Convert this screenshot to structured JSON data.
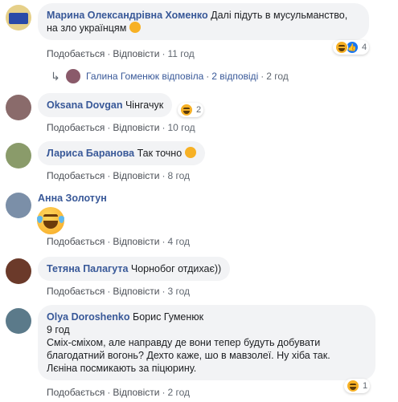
{
  "labels": {
    "like": "Подобається",
    "reply": "Відповісти",
    "dot": "·"
  },
  "comments": [
    {
      "author": "Марина Олександрівна Хоменко",
      "text_line1": "Далі підуть в мусульманство,",
      "text_line2": "на зло українцям",
      "time": "11 год",
      "reactions": "4",
      "reaction_types": [
        "haha",
        "like"
      ],
      "avatar_color": "#d9c27a"
    },
    {
      "author": "Oksana Dovgan",
      "text": "Чінгачук",
      "time": "10 год",
      "reactions": "2",
      "reaction_types": [
        "haha"
      ],
      "avatar_color": "#8a6b6b"
    },
    {
      "author": "Лариса Баранова",
      "text": "Так точно",
      "time": "8 год",
      "avatar_color": "#8a9b6a"
    },
    {
      "author": "Анна Золотун",
      "time": "4 год",
      "avatar_color": "#7b8fa8"
    },
    {
      "author": "Тетяна Палагута",
      "text": "Чорнобог отдихає))",
      "time": "3 год",
      "avatar_color": "#6b3a2a"
    },
    {
      "author": "Olya Doroshenko",
      "tag": "Борис Гуменюк",
      "subtime": "9 год",
      "text_line1": "Сміх-сміхом, але направду де вони тепер будуть добувати",
      "text_line2": "благодатний вогонь? Дехто каже, шо в мавзолеї. Ну хіба так.",
      "text_line3": "Лєніна посмикають за піцюрину.",
      "time": "2 год",
      "reactions": "1",
      "reaction_types": [
        "haha"
      ],
      "avatar_color": "#5b7a8a"
    }
  ],
  "reply_thread": {
    "author": "Галина Гоменюк",
    "action": "відповіла",
    "count": "2 відповіді",
    "time": "2 год",
    "avatar_color": "#8a5a6a"
  }
}
